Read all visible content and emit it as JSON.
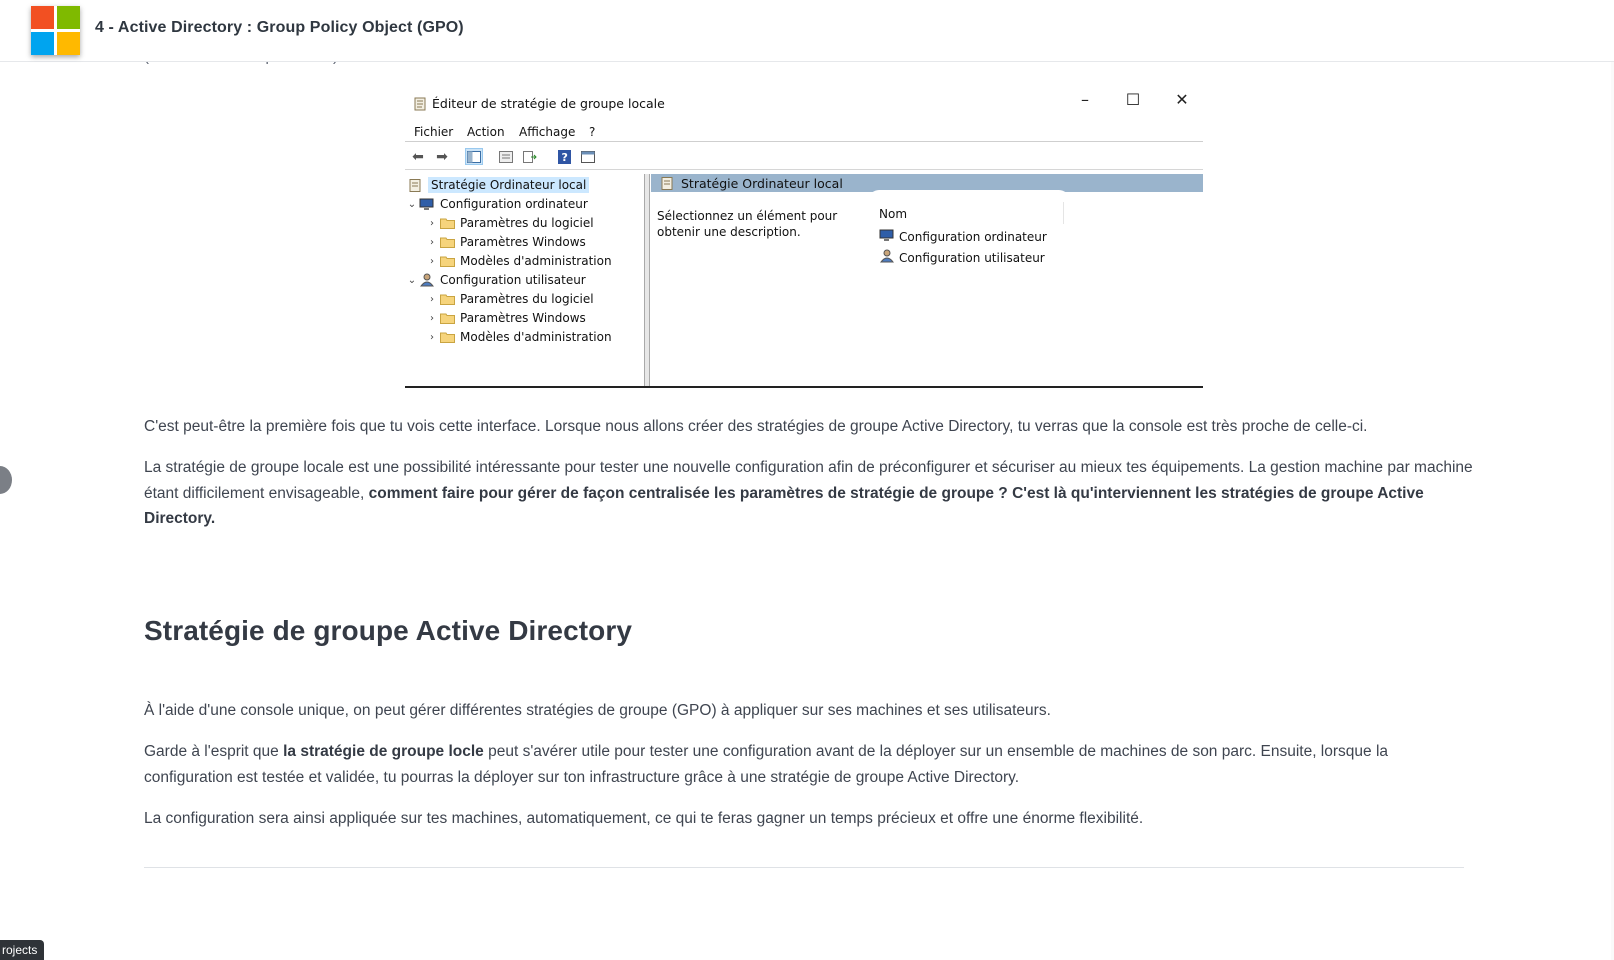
{
  "header": {
    "title": "4 - Active Directory : Group Policy Object (GPO)",
    "logo_colors": [
      "#f25022",
      "#7fba00",
      "#00a4ef",
      "#ffb900"
    ]
  },
  "peek_text": "(\"WORKGROUP\" par défaut).",
  "editor": {
    "window_title": "Éditeur de stratégie de groupe locale",
    "controls": {
      "minimize": "–",
      "maximize": "☐",
      "close": "✕"
    },
    "menu": [
      "Fichier",
      "Action",
      "Affichage",
      "?"
    ],
    "tree": {
      "root": "Stratégie Ordinateur local",
      "computer": "Configuration ordinateur",
      "user": "Configuration utilisateur",
      "computer_children": [
        "Paramètres du logiciel",
        "Paramètres Windows",
        "Modèles d'administration"
      ],
      "user_children": [
        "Paramètres du logiciel",
        "Paramètres Windows",
        "Modèles d'administration"
      ]
    },
    "right_pane": {
      "header": "Stratégie Ordinateur local",
      "description": "Sélectionnez un élément pour obtenir une description.",
      "column": "Nom",
      "items": [
        "Configuration ordinateur",
        "Configuration utilisateur"
      ]
    }
  },
  "article": {
    "p1": "C'est peut-être la première fois que tu vois cette interface. Lorsque nous allons créer des stratégies de groupe Active Directory, tu verras que la console est très proche de celle-ci.",
    "p2_a": "La stratégie de groupe locale est une possibilité intéressante pour tester une nouvelle configuration afin de préconfigurer et sécuriser au mieux tes équipements. La gestion machine par machine étant difficilement envisageable, ",
    "p2_b": "comment faire pour gérer de façon centralisée les paramètres de stratégie de groupe ? C'est là qu'interviennent les stratégies de groupe Active Directory.",
    "heading": "Stratégie de groupe Active Directory",
    "p3": "À l'aide d'une console unique, on peut gérer différentes stratégies de groupe (GPO) à appliquer sur ses machines et ses utilisateurs.",
    "p4_a": "Garde à l'esprit que ",
    "p4_b": "la stratégie de groupe locle",
    "p4_c": " peut s'avérer utile pour tester une configuration avant de la déployer sur un ensemble de machines de son parc. Ensuite, lorsque la configuration est testée et validée, tu pourras la déployer sur ton infrastructure grâce à une stratégie de groupe Active Directory.",
    "p5": "La configuration sera ainsi appliquée sur tes machines, automatiquement, ce qui te feras gagner un temps précieux et offre une énorme flexibilité."
  },
  "badge": "rojects"
}
